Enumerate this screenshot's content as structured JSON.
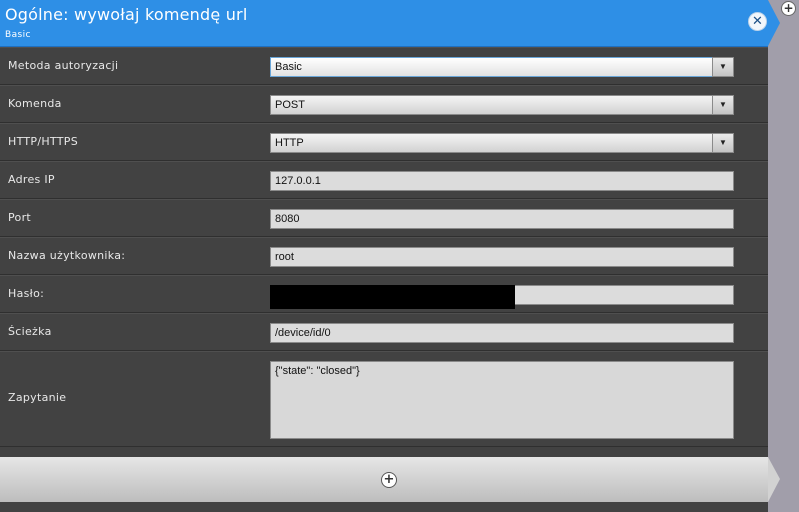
{
  "header": {
    "title": "Ogólne: wywołaj komendę url",
    "subtitle": "Basic",
    "close_icon": "close-icon",
    "corner_icon": "plus-icon"
  },
  "colors": {
    "header_bg": "#2e8fe6",
    "panel_bg": "#424242",
    "side_bg": "#a19eaa"
  },
  "rows": [
    {
      "label": "Metoda autoryzacji",
      "type": "dropdown",
      "value": "Basic"
    },
    {
      "label": "Komenda",
      "type": "dropdown",
      "value": "POST"
    },
    {
      "label": "HTTP/HTTPS",
      "type": "dropdown",
      "value": "HTTP"
    },
    {
      "label": "Adres IP",
      "type": "input",
      "value": "127.0.0.1"
    },
    {
      "label": "Port",
      "type": "input",
      "value": "8080"
    },
    {
      "label": "Nazwa użytkownika:",
      "type": "input",
      "value": "root"
    },
    {
      "label": "Hasło:",
      "type": "password",
      "value": ""
    },
    {
      "label": "Ścieżka",
      "type": "input",
      "value": "/device/id/0"
    },
    {
      "label": "Zapytanie",
      "type": "textarea",
      "value": "{\"state\": \"closed\"}"
    }
  ],
  "footer": {
    "add_icon": "plus-icon"
  }
}
